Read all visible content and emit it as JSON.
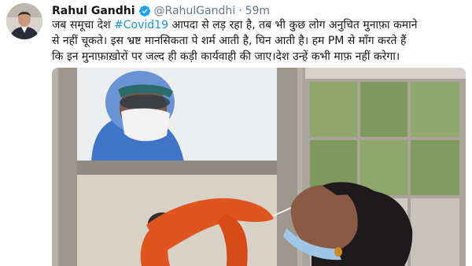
{
  "tweet": {
    "display_name": "Rahul Gandhi",
    "verified": true,
    "handle": "@RahulGandhi",
    "separator": "·",
    "time": "59m",
    "text_lines": [
      {
        "before": "जब समूचा देश ",
        "hashtag": "#Covid19",
        "after": " आपदा से लड़ रहा है, तब भी कुछ लोग अनुचित मुनाफ़ा कमाने"
      },
      {
        "text": "से नहीं चूकते। इस भ्रष्ट मानसिकता पे शर्म आती है, घिन आती है। हम PM से माँग करते हैं"
      },
      {
        "text": "कि इन मुनाफ़ाख़ोरों पर जल्द ही कड़ी कार्यवाही की जाए।देश उन्हें कभी माफ़ नहीं करेगा।"
      }
    ]
  },
  "icons": {
    "avatar": "profile-avatar",
    "verified": "verified-badge-icon"
  },
  "colors": {
    "link": "#1b95e0",
    "secondary_text": "#657786",
    "verified": "#1da1f2",
    "glove": "#e0541f",
    "ppe": "#3f74c9"
  }
}
